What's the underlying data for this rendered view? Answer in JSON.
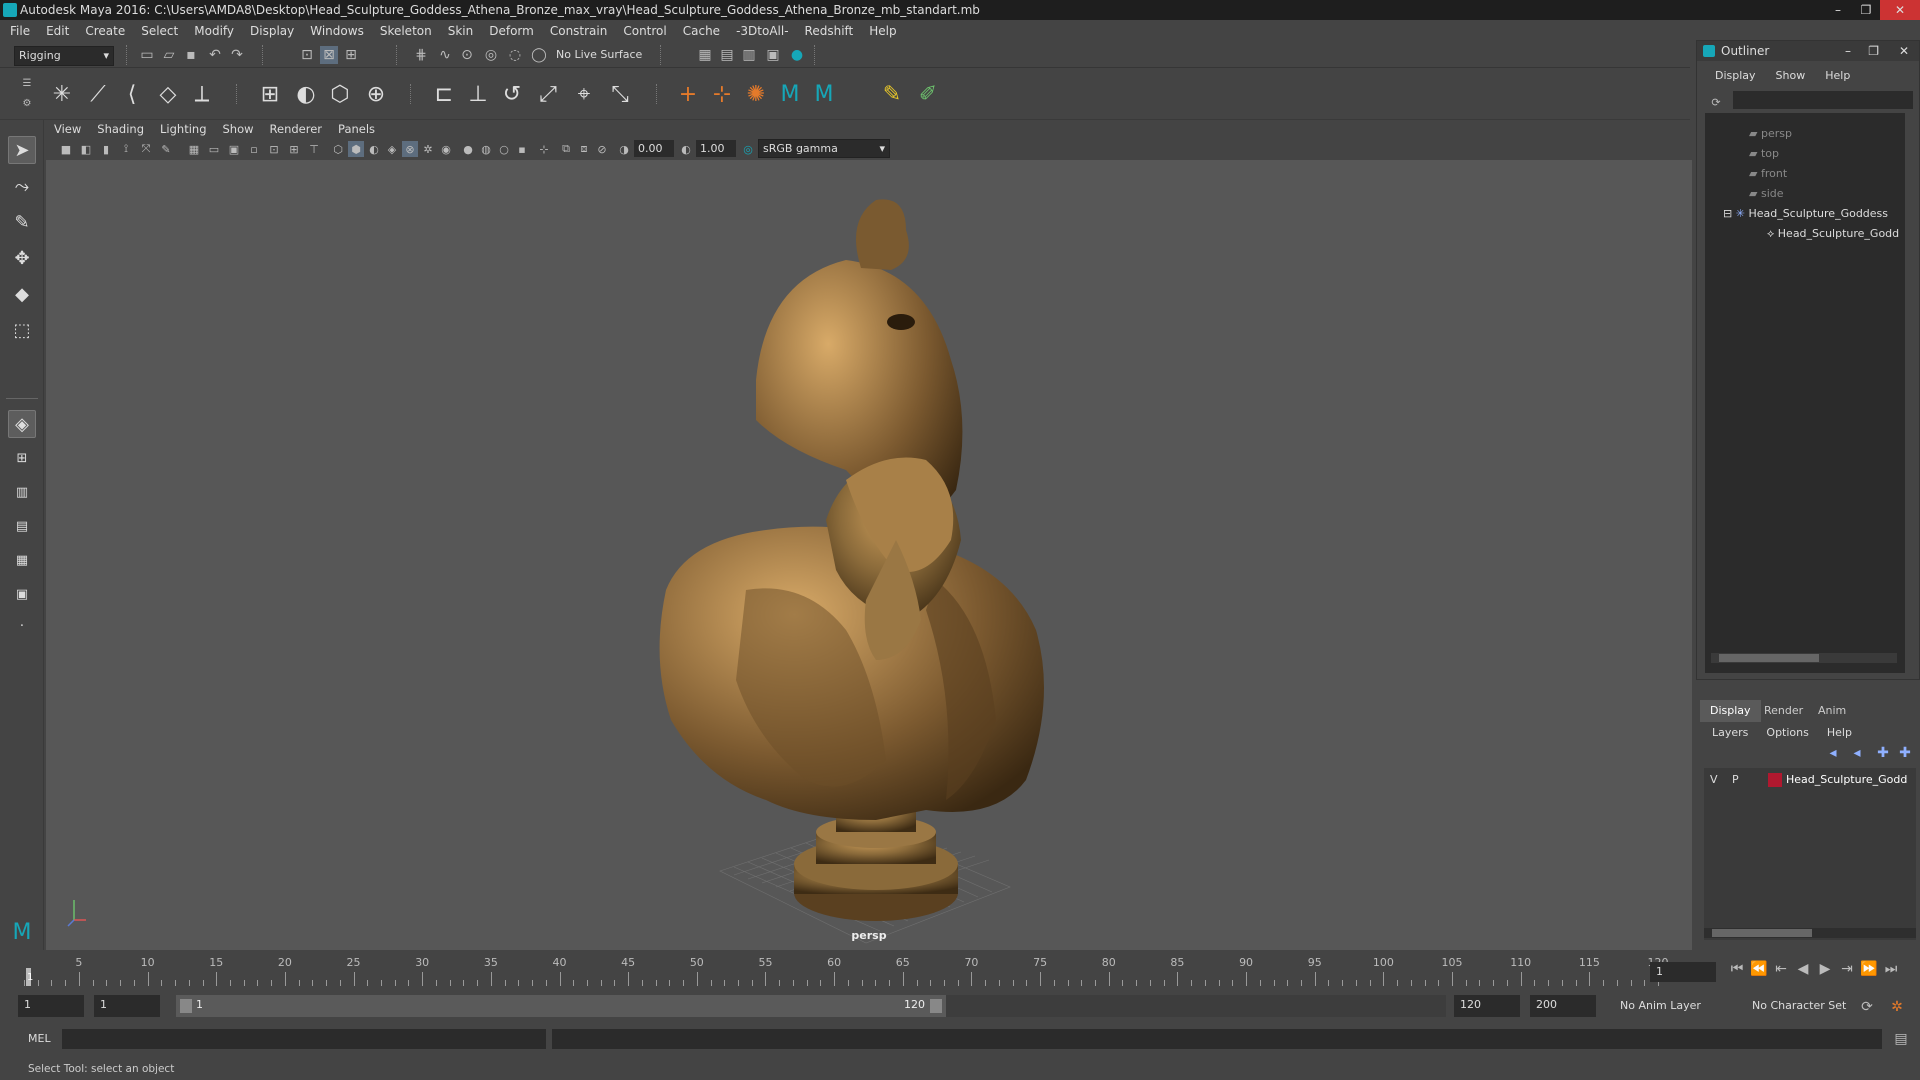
{
  "window": {
    "title": "Autodesk Maya 2016: C:\\Users\\AMDA8\\Desktop\\Head_Sculpture_Goddess_Athena_Bronze_max_vray\\Head_Sculpture_Goddess_Athena_Bronze_mb_standart.mb",
    "minimize": "–",
    "maximize": "❐",
    "close": "✕"
  },
  "menubar": [
    "File",
    "Edit",
    "Create",
    "Select",
    "Modify",
    "Display",
    "Windows",
    "Skeleton",
    "Skin",
    "Deform",
    "Constrain",
    "Control",
    "Cache",
    "-3DtoAll-",
    "Redshift",
    "Help"
  ],
  "status": {
    "menuset": "Rigging",
    "live_surface": "No Live Surface"
  },
  "panel": {
    "menus": [
      "View",
      "Shading",
      "Lighting",
      "Show",
      "Renderer",
      "Panels"
    ],
    "exposure": "0.00",
    "gamma": "1.00",
    "colorspace": "sRGB gamma",
    "camera_label": "persp"
  },
  "timeline": {
    "labels": [
      "5",
      "10",
      "15",
      "20",
      "25",
      "30",
      "35",
      "40",
      "45",
      "50",
      "55",
      "60",
      "65",
      "70",
      "75",
      "80",
      "85",
      "90",
      "95",
      "100",
      "105",
      "110",
      "115",
      "120"
    ],
    "current_frame_marker": "1",
    "current_frame": "1"
  },
  "range": {
    "start": "1",
    "playback_start": "1",
    "slider_start": "1",
    "slider_end": "120",
    "playback_end": "120",
    "end": "200",
    "anim_layer": "No Anim Layer",
    "char_set": "No Character Set"
  },
  "cmdline": {
    "label": "MEL"
  },
  "helpline": {
    "text": "Select Tool: select an object"
  },
  "outliner": {
    "title": "Outliner",
    "menus": [
      "Display",
      "Show",
      "Help"
    ],
    "items": [
      {
        "label": "persp"
      },
      {
        "label": "top"
      },
      {
        "label": "front"
      },
      {
        "label": "side"
      },
      {
        "label": "Head_Sculpture_Goddess"
      },
      {
        "label": "Head_Sculpture_Godd"
      }
    ]
  },
  "layer_editor": {
    "tabs": [
      "Display",
      "Render",
      "Anim"
    ],
    "menus": [
      "Layers",
      "Options",
      "Help"
    ],
    "layer": {
      "v": "V",
      "p": "P",
      "name": "Head_Sculpture_Godd",
      "color": "#b0182f"
    }
  },
  "colors": {
    "accent": "#16a7b8",
    "bronze": "#8a6a3a"
  }
}
